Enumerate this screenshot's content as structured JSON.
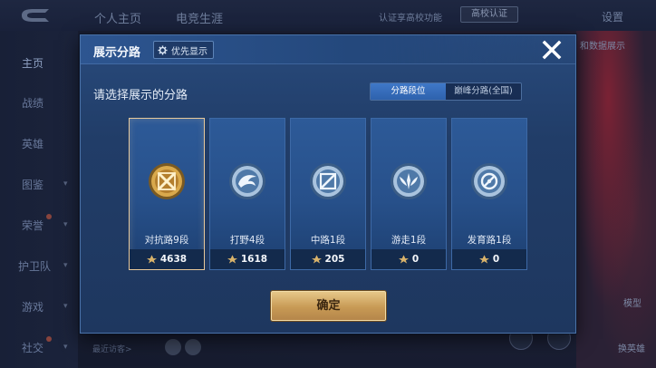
{
  "topbar": {
    "tabs": [
      "个人主页",
      "电竞生涯"
    ],
    "campus_text": "认证享高校功能",
    "campus_badge": "高校认证",
    "settings": "设置"
  },
  "sidebar": {
    "items": [
      {
        "label": "主页",
        "active": true
      },
      {
        "label": "战绩"
      },
      {
        "label": "英雄"
      },
      {
        "label": "图鉴",
        "chevron": true
      },
      {
        "label": "荣誉",
        "chevron": true,
        "dot": true
      },
      {
        "label": "护卫队",
        "chevron": true
      },
      {
        "label": "游戏",
        "chevron": true
      },
      {
        "label": "社交",
        "chevron": true,
        "dot": true
      }
    ]
  },
  "background": {
    "right_label": "和数据展示",
    "bottom_text": "最近访客>",
    "right_bottom_labels": [
      "模型",
      "换英雄"
    ]
  },
  "dialog": {
    "title": "展示分路",
    "priority_button": "优先显示",
    "prompt": "请选择展示的分路",
    "segments": [
      {
        "label": "分路段位",
        "active": true
      },
      {
        "label": "巅峰分路(全国)",
        "active": false
      }
    ],
    "cards": [
      {
        "name": "对抗路9段",
        "score": "4638",
        "selected": true,
        "icon": "clash-lane-gold-emblem-icon"
      },
      {
        "name": "打野4段",
        "score": "1618",
        "selected": false,
        "icon": "jungle-silver-emblem-icon"
      },
      {
        "name": "中路1段",
        "score": "205",
        "selected": false,
        "icon": "mid-lane-silver-emblem-icon"
      },
      {
        "name": "游走1段",
        "score": "0",
        "selected": false,
        "icon": "roam-silver-emblem-icon"
      },
      {
        "name": "发育路1段",
        "score": "0",
        "selected": false,
        "icon": "farm-lane-silver-emblem-icon"
      }
    ],
    "confirm": "确定"
  },
  "colors": {
    "gold_accent": "#e8c89a",
    "active_tab": "#3f78c8",
    "confirm_gold": "#c89a55"
  }
}
